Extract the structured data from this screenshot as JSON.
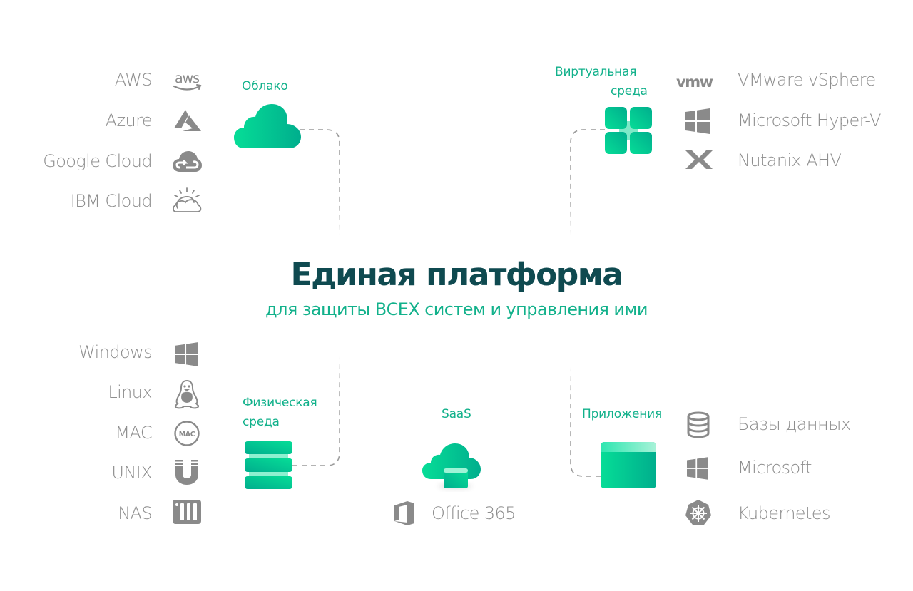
{
  "headline": {
    "title": "Единая платформа",
    "subtitle": "для защиты ВСЕХ систем и управления ими"
  },
  "colors": {
    "accent": "#12b18b",
    "gradient_start": "#06dd97",
    "gradient_end": "#00ae8d",
    "title": "#0f4a50",
    "item_text": "#8e8e8e",
    "icon": "#8a8a8a",
    "connector": "#9a9a9a"
  },
  "categories": {
    "cloud": {
      "label": "Облако",
      "icon": "cloud-icon",
      "items": [
        {
          "label": "AWS",
          "icon": "aws-icon"
        },
        {
          "label": "Azure",
          "icon": "azure-icon"
        },
        {
          "label": "Google Cloud",
          "icon": "google-cloud-icon"
        },
        {
          "label": "IBM Cloud",
          "icon": "ibm-cloud-icon"
        }
      ]
    },
    "virtual": {
      "label_line1": "Виртуальная",
      "label_line2": "среда",
      "icon": "virtual-grid-icon",
      "items": [
        {
          "label": "VMware vSphere",
          "icon": "vmware-icon"
        },
        {
          "label": "Microsoft  Hyper-V",
          "icon": "windows-icon"
        },
        {
          "label": "Nutanix AHV",
          "icon": "nutanix-icon"
        }
      ]
    },
    "physical": {
      "label_line1": "Физическая",
      "label_line2": "среда",
      "icon": "server-stack-icon",
      "items": [
        {
          "label": "Windows",
          "icon": "windows-icon"
        },
        {
          "label": "Linux",
          "icon": "linux-icon"
        },
        {
          "label": "MAC",
          "icon": "mac-icon"
        },
        {
          "label": "UNIX",
          "icon": "unix-icon"
        },
        {
          "label": "NAS",
          "icon": "nas-icon"
        }
      ]
    },
    "saas": {
      "label": "SaaS",
      "icon": "saas-cloud-icon",
      "items": [
        {
          "label": "Office 365",
          "icon": "office365-icon"
        }
      ],
      "mac_badge": "MAC"
    },
    "apps": {
      "label": "Приложения",
      "icon": "app-window-icon",
      "items": [
        {
          "label": "Базы данных",
          "icon": "database-icon"
        },
        {
          "label": "Microsoft",
          "icon": "windows-icon"
        },
        {
          "label": "Kubernetes",
          "icon": "kubernetes-icon"
        }
      ]
    }
  }
}
